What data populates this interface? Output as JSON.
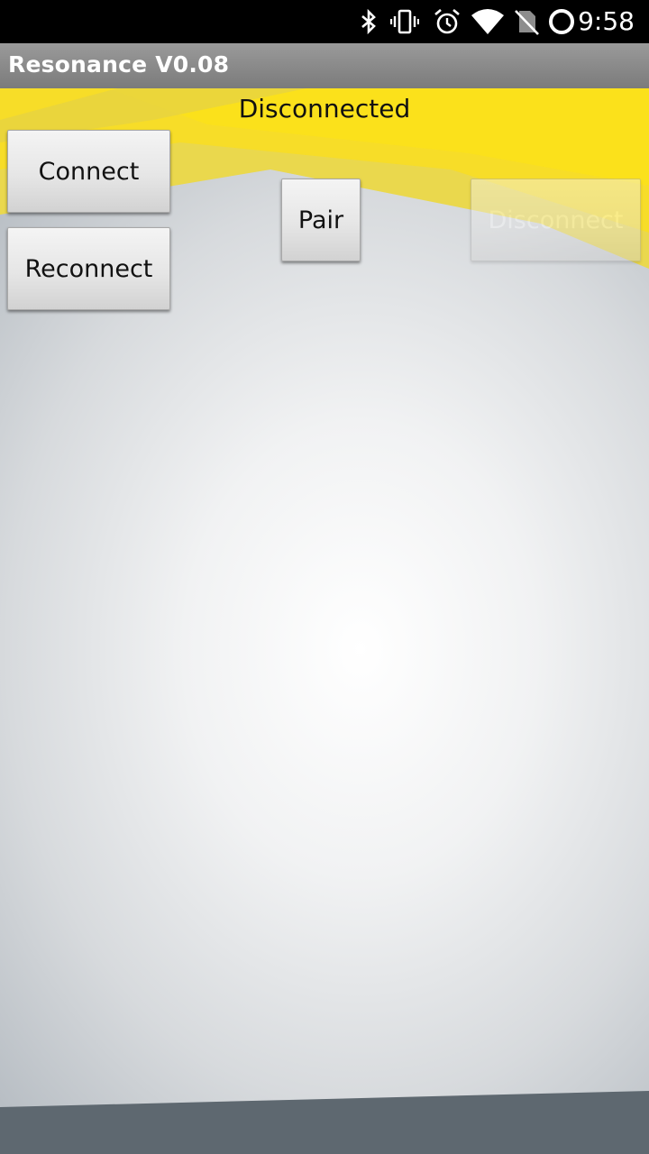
{
  "status_bar": {
    "time": "9:58",
    "icons": [
      "bluetooth-icon",
      "vibrate-icon",
      "alarm-icon",
      "wifi-icon",
      "no-sim-icon",
      "battery-charging-icon"
    ]
  },
  "app": {
    "title": "Resonance V0.08"
  },
  "main": {
    "connection_status": "Disconnected",
    "buttons": {
      "connect": "Connect",
      "reconnect": "Reconnect",
      "pair": "Pair",
      "disconnect": "Disconnect"
    },
    "disconnect_enabled": false
  },
  "colors": {
    "accent_yellow": "#f9e020",
    "action_bar": "#8a8a8a",
    "bottom_band": "#5e6870"
  }
}
